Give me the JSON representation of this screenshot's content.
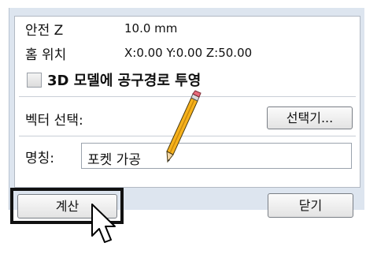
{
  "safe_z": {
    "label": "안전 Z",
    "value": "10.0 mm"
  },
  "home_position": {
    "label": "홈 위치",
    "value": "X:0.00 Y:0.00 Z:50.00"
  },
  "project_option": {
    "label": "3D 모델에 공구경로 투영",
    "checked": false
  },
  "vector_select": {
    "label": "벡터 선택:",
    "button_label": "선택기..."
  },
  "name": {
    "label": "명칭:",
    "value": "포켓 가공"
  },
  "buttons": {
    "calculate": "계산",
    "close": "닫기"
  },
  "icons": {
    "pencil": "pencil-icon",
    "cursor": "mouse-pointer-icon"
  },
  "colors": {
    "panel_background": "#dde5ef",
    "highlight_border": "#111111",
    "pencil_body": "#f7b21c"
  }
}
